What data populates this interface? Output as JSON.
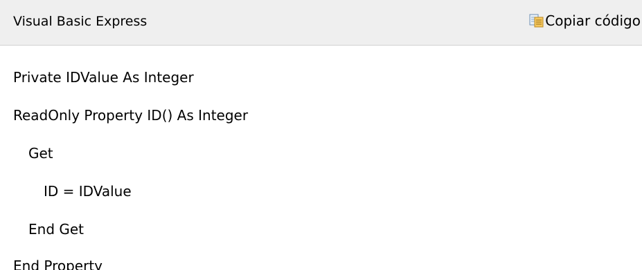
{
  "header": {
    "language_label": "Visual Basic Express",
    "copy_label": "Copiar código",
    "copy_icon": "copy-code-icon"
  },
  "code": {
    "lines": [
      "Private IDValue As Integer",
      "ReadOnly Property ID() As Integer",
      "Get",
      "ID = IDValue",
      "End Get",
      "End Property"
    ]
  },
  "colors": {
    "header_background": "#efefef",
    "header_border": "#d0d0d0",
    "text": "#000000"
  }
}
